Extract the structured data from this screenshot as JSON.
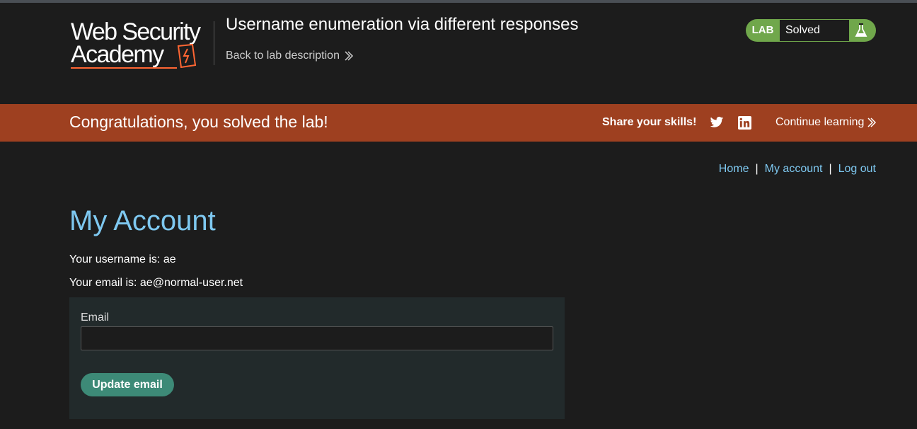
{
  "header": {
    "logo_line1": "Web Security",
    "logo_line2": "Academy",
    "lab_title": "Username enumeration via different responses",
    "back_link": "Back to lab description",
    "status_badge": {
      "lab_label": "LAB",
      "status": "Solved",
      "color": "#70a74b"
    }
  },
  "banner": {
    "message": "Congratulations, you solved the lab!",
    "share_label": "Share your skills!",
    "continue_label": "Continue learning",
    "color": "#9e4020",
    "icons": [
      "twitter-icon",
      "linkedin-icon",
      "double-chevron-right-icon"
    ]
  },
  "nav": {
    "home": "Home",
    "my_account": "My account",
    "log_out": "Log out",
    "separator": "|"
  },
  "main": {
    "title": "My Account",
    "username_text": "Your username is: ae",
    "email_text": "Your email is: ae@normal-user.net",
    "form": {
      "email_label": "Email",
      "email_value": "",
      "submit_label": "Update email"
    }
  },
  "colors": {
    "background": "#1c1c1c",
    "link": "#7ec8f0",
    "button": "#3d8a77",
    "form_panel": "#222a2b"
  }
}
